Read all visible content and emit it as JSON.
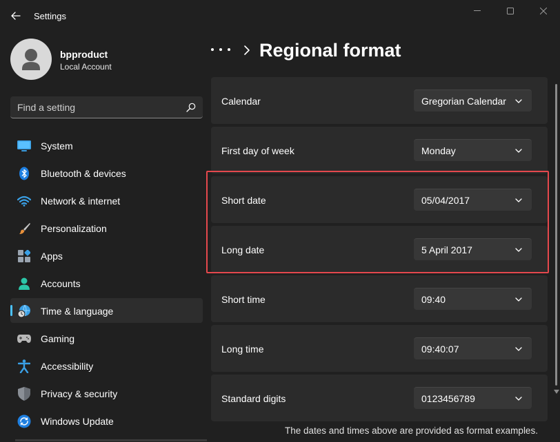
{
  "window": {
    "title": "Settings"
  },
  "profile": {
    "name": "bpproduct",
    "account_type": "Local Account"
  },
  "search": {
    "placeholder": "Find a setting"
  },
  "nav": {
    "items": [
      {
        "label": "System",
        "icon": "monitor-icon"
      },
      {
        "label": "Bluetooth & devices",
        "icon": "bluetooth-icon"
      },
      {
        "label": "Network & internet",
        "icon": "wifi-icon"
      },
      {
        "label": "Personalization",
        "icon": "brush-icon"
      },
      {
        "label": "Apps",
        "icon": "apps-icon"
      },
      {
        "label": "Accounts",
        "icon": "person-icon"
      },
      {
        "label": "Time & language",
        "icon": "globe-clock-icon",
        "active": true
      },
      {
        "label": "Gaming",
        "icon": "gamepad-icon"
      },
      {
        "label": "Accessibility",
        "icon": "accessibility-icon"
      },
      {
        "label": "Privacy & security",
        "icon": "shield-icon"
      },
      {
        "label": "Windows Update",
        "icon": "update-icon"
      }
    ]
  },
  "header": {
    "page_title": "Regional format"
  },
  "settings": {
    "rows": [
      {
        "label": "Calendar",
        "value": "Gregorian Calendar"
      },
      {
        "label": "First day of week",
        "value": "Monday"
      },
      {
        "label": "Short date",
        "value": "05/04/2017"
      },
      {
        "label": "Long date",
        "value": "5 April 2017"
      },
      {
        "label": "Short time",
        "value": "09:40"
      },
      {
        "label": "Long time",
        "value": "09:40:07"
      },
      {
        "label": "Standard digits",
        "value": "0123456789"
      }
    ]
  },
  "footer": {
    "note": "The dates and times above are provided as format examples."
  },
  "colors": {
    "accent": "#4cc2ff",
    "highlight": "#e5484d",
    "background": "#202020",
    "card": "#2b2b2b"
  }
}
